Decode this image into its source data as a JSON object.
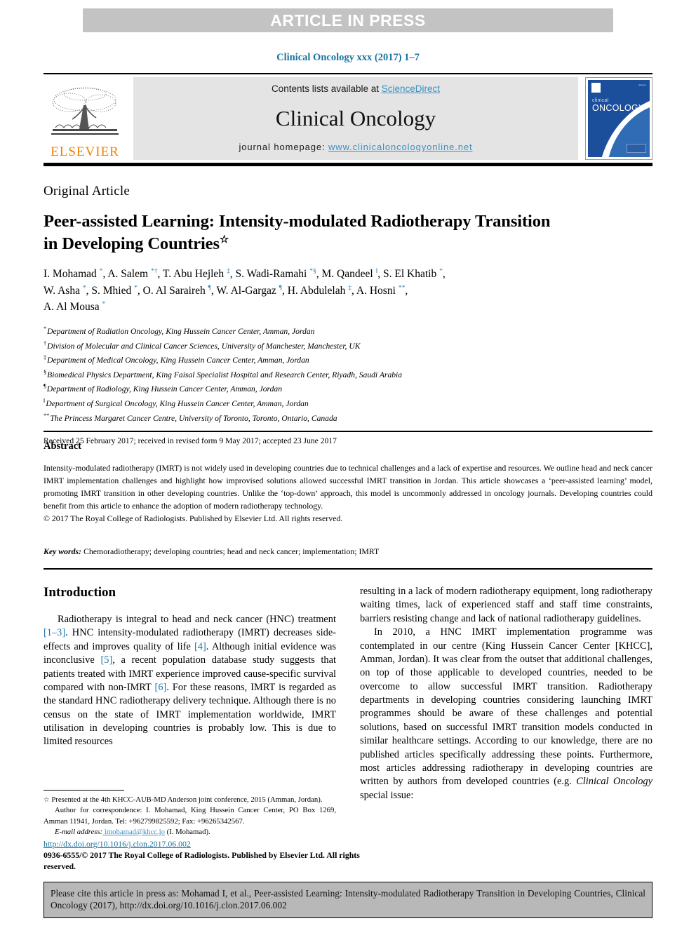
{
  "press_band": {
    "label": "ARTICLE IN PRESS"
  },
  "running_citation": "Clinical Oncology xxx (2017) 1–7",
  "masthead": {
    "publisher": "ELSEVIER",
    "contents_prefix": "Contents lists available at ",
    "contents_link": "ScienceDirect",
    "journal_title": "Clinical Oncology",
    "homepage_prefix": "journal homepage: ",
    "homepage_link": "www.clinicaloncologyonline.net",
    "cover": {
      "line_small": "clinical",
      "line_big": "ONCOLOGY",
      "corner_text": "Elsevier"
    }
  },
  "article": {
    "type": "Original Article",
    "title_line1": "Peer-assisted Learning: Intensity-modulated Radiotherapy Transition",
    "title_line2": "in Developing Countries",
    "title_mark": "☆",
    "authors_html": "I. Mohamad <sup class=\"sup-blue\">*</sup>, A. Salem <sup class=\"sup-blue\">*</sup><sup class=\"sup-blue\">†</sup>, T. Abu Hejleh <sup class=\"sup-blue\">‡</sup>, S. Wadi-Ramahi <sup class=\"sup-blue\">*</sup><sup class=\"sup-blue\">§</sup>, M. Qandeel <sup class=\"sup-blue\">‖</sup>, S. El Khatib <sup class=\"sup-blue\">*</sup>,<br>W. Asha <sup class=\"sup-blue\">*</sup>, S. Mhied <sup class=\"sup-blue\">*</sup>, O. Al Saraireh <sup class=\"sup-blue\">¶</sup>, W. Al-Gargaz <sup class=\"sup-blue\">¶</sup>, H. Abdulelah <sup class=\"sup-blue\">‡</sup>, A. Hosni <sup class=\"sup-blue\">**</sup>,<br>A. Al Mousa <sup class=\"sup-blue\">*</sup>",
    "affiliations": [
      {
        "mark": "*",
        "text": "Department of Radiation Oncology, King Hussein Cancer Center, Amman, Jordan"
      },
      {
        "mark": "†",
        "text": "Division of Molecular and Clinical Cancer Sciences, University of Manchester, Manchester, UK"
      },
      {
        "mark": "‡",
        "text": "Department of Medical Oncology, King Hussein Cancer Center, Amman, Jordan"
      },
      {
        "mark": "§",
        "text": "Biomedical Physics Department, King Faisal Specialist Hospital and Research Center, Riyadh, Saudi Arabia"
      },
      {
        "mark": "¶",
        "text": "Department of Radiology, King Hussein Cancer Center, Amman, Jordan"
      },
      {
        "mark": "‖",
        "text": "Department of Surgical Oncology, King Hussein Cancer Center, Amman, Jordan"
      },
      {
        "mark": "**",
        "text": "The Princess Margaret Cancer Centre, University of Toronto, Toronto, Ontario, Canada"
      }
    ],
    "received": "Received 25 February 2017; received in revised form 9 May 2017; accepted 23 June 2017"
  },
  "abstract": {
    "heading": "Abstract",
    "text": "Intensity-modulated radiotherapy (IMRT) is not widely used in developing countries due to technical challenges and a lack of expertise and resources. We outline head and neck cancer IMRT implementation challenges and highlight how improvised solutions allowed successful IMRT transition in Jordan. This article showcases a ‘peer-assisted learning’ model, promoting IMRT transition in other developing countries. Unlike the ‘top-down’ approach, this model is uncommonly addressed in oncology journals. Developing countries could benefit from this article to enhance the adoption of modern radiotherapy technology.",
    "copyright": "© 2017 The Royal College of Radiologists. Published by Elsevier Ltd. All rights reserved.",
    "keywords_label": "Key words:",
    "keywords_value": " Chemoradiotherapy; developing countries; head and neck cancer; implementation; IMRT"
  },
  "body": {
    "section_heading": "Introduction",
    "left_paragraph_html": "Radiotherapy is integral to head and neck cancer (HNC) treatment <span class=\"ref-blue\">[1–3]</span>. HNC intensity-modulated radiotherapy (IMRT) decreases side-effects and improves quality of life <span class=\"ref-blue\">[4]</span>. Although initial evidence was inconclusive <span class=\"ref-blue\">[5]</span>, a recent population database study suggests that patients treated with IMRT experience improved cause-specific survival compared with non-IMRT <span class=\"ref-blue\">[6]</span>. For these reasons, IMRT is regarded as the standard HNC radiotherapy delivery technique. Although there is no census on the state of IMRT implementation worldwide, IMRT utilisation in developing countries is probably low. This is due to limited resources",
    "right_paragraph1": "resulting in a lack of modern radiotherapy equipment, long radiotherapy waiting times, lack of experienced staff and staff time constraints, barriers resisting change and lack of national radiotherapy guidelines.",
    "right_paragraph2_html": "In 2010, a HNC IMRT implementation programme was contemplated in our centre (King Hussein Cancer Center [KHCC], Amman, Jordan). It was clear from the outset that additional challenges, on top of those applicable to developed countries, needed to be overcome to allow successful IMRT transition. Radiotherapy departments in developing countries considering launching IMRT programmes should be aware of these challenges and potential solutions, based on successful IMRT transition models conducted in similar healthcare settings. According to our knowledge, there are no published articles specifically addressing these points. Furthermore, most articles addressing radiotherapy in developing countries are written by authors from developed countries (e.g. <span class=\"ital\">Clinical Oncology</span> special issue:"
  },
  "footnotes": {
    "conference_mark": "☆",
    "conference_text": " Presented at the 4th KHCC-AUB-MD Anderson joint conference, 2015 (Amman, Jordan).",
    "correspondence_text": "Author for correspondence: I. Mohamad, King Hussein Cancer Center, PO Box 1269, Amman 11941, Jordan. Tel: +962799825592; Fax: +96265342567.",
    "email_label": "E-mail address:",
    "email_value": " imohamad@khcc.jo",
    "email_suffix": " (I. Mohamad)."
  },
  "footer": {
    "doi_url": "http://dx.doi.org/10.1016/j.clon.2017.06.002",
    "issn_line": "0936-6555/© 2017 The Royal College of Radiologists. Published by Elsevier Ltd. All rights reserved."
  },
  "cite_box": {
    "text": "Please cite this article in press as: Mohamad I, et al., Peer-assisted Learning: Intensity-modulated Radiotherapy Transition in Developing Countries, Clinical Oncology (2017), http://dx.doi.org/10.1016/j.clon.2017.06.002"
  },
  "colors": {
    "press_band_bg": "#c3c3c3",
    "link_blue": "#3a8fc4",
    "citation_blue": "#1a73a0",
    "reference_blue": "#1a78ab",
    "elsevier_orange": "#ef8200",
    "cover_blue": "#1b4f9c",
    "cite_box_bg": "#b8b8b8"
  }
}
